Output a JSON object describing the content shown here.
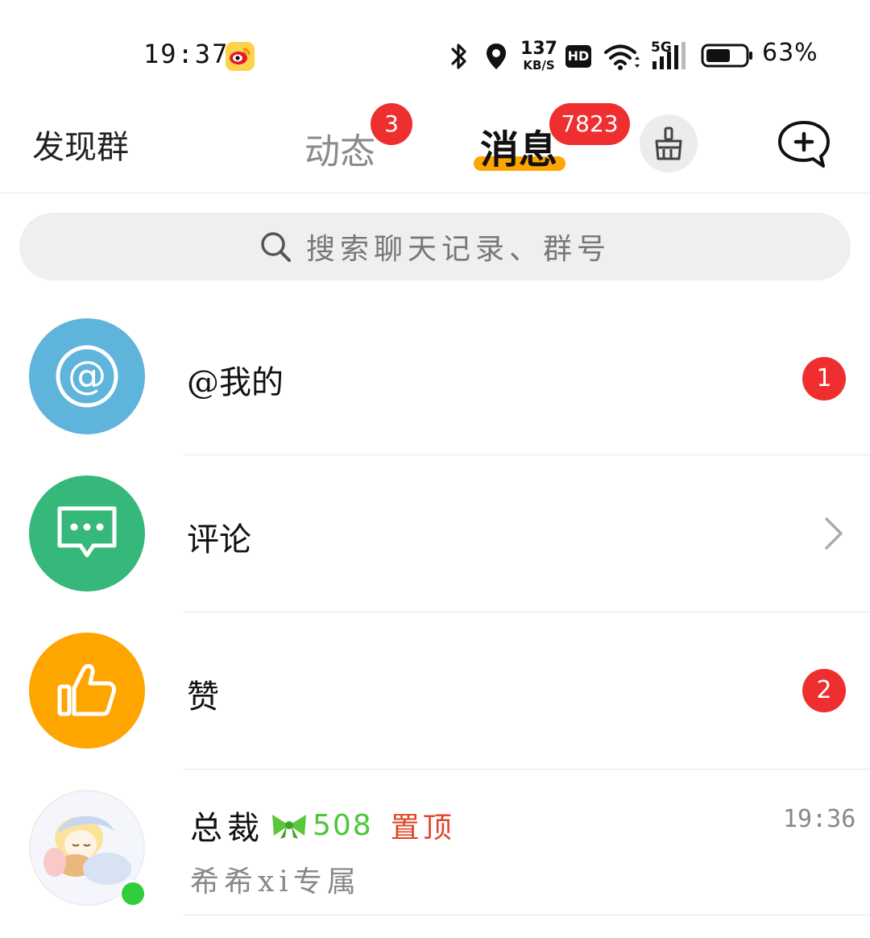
{
  "status_bar": {
    "time": "19:37",
    "app_icon": "weibo-icon",
    "network_speed": "137",
    "network_unit": "KB/S",
    "hd_label": "HD",
    "cellular_label": "5G",
    "battery_percent": "63%",
    "battery_level": 0.63
  },
  "header": {
    "left_tab": "发现群",
    "tabs": [
      {
        "label": "动态",
        "badge": "3"
      },
      {
        "label": "消息",
        "badge": "7823",
        "active": true
      }
    ],
    "clean_icon": "broom-icon",
    "add_icon": "add-chat-icon",
    "accent_color": "#ffa500"
  },
  "search": {
    "placeholder": "搜索聊天记录、群号"
  },
  "list": {
    "mention": {
      "label": "@我的",
      "unread": "1",
      "color": "#5fb4dc"
    },
    "comment": {
      "label": "评论",
      "color": "#35b87a"
    },
    "like": {
      "label": "赞",
      "unread": "2",
      "color": "#ffa500"
    },
    "chat": {
      "name": "总裁",
      "number": "508",
      "pinned_label": "置顶",
      "time": "19:36",
      "preview": "希希xi专属",
      "online": true
    }
  },
  "colors": {
    "badge_red": "#ef2f2f",
    "online_green": "#2fce3a",
    "pinned_red": "#e0442a",
    "number_green": "#4cc73a"
  }
}
